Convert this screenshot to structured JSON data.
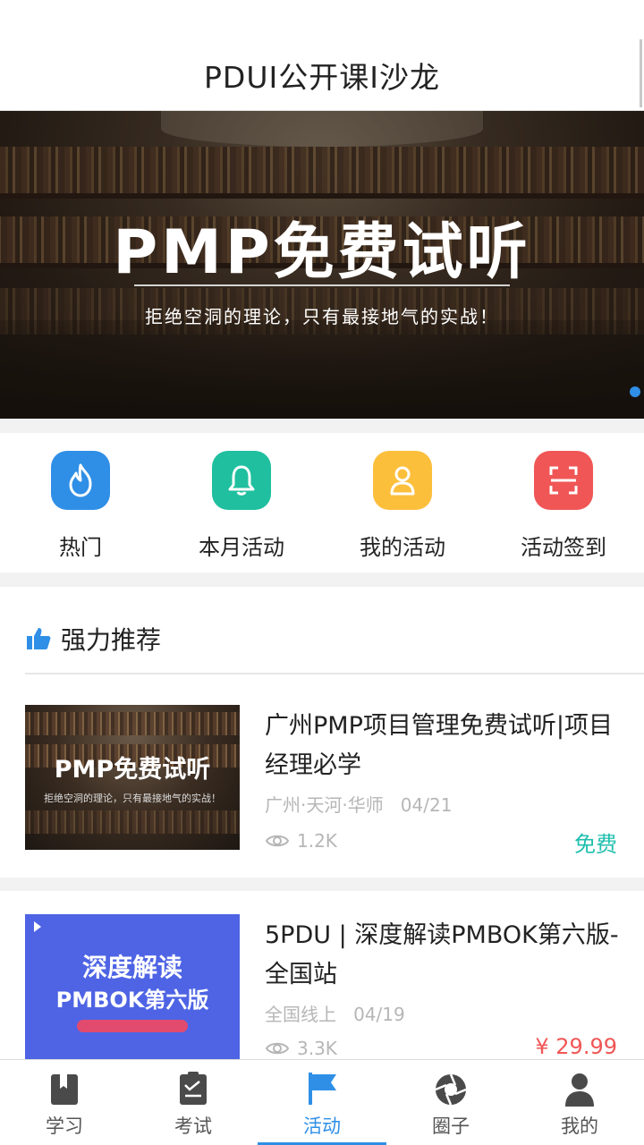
{
  "header": {
    "title": "PDUI公开课I沙龙"
  },
  "banner": {
    "headline": "PMP免费试听",
    "subtitle": "拒绝空洞的理论，只有最接地气的实战！"
  },
  "quick_actions": [
    {
      "label": "热门",
      "icon": "flame-icon",
      "color": "#2f8fe6"
    },
    {
      "label": "本月活动",
      "icon": "bell-icon",
      "color": "#1fbf9f"
    },
    {
      "label": "我的活动",
      "icon": "user-icon",
      "color": "#fcbf3c"
    },
    {
      "label": "活动签到",
      "icon": "scan-icon",
      "color": "#f05656"
    }
  ],
  "recommend": {
    "heading": "强力推荐",
    "icon": "thumbs-up-icon"
  },
  "cards": [
    {
      "thumb_title": "PMP免费试听",
      "thumb_sub": "拒绝空洞的理论，只有最接地气的实战！",
      "title": "广州PMP项目管理免费试听|项目经理必学",
      "location": "广州·天河·华师",
      "date": "04/21",
      "views": "1.2K",
      "price": "免费",
      "price_color": "#1fbfae"
    },
    {
      "thumb_line1": "深度解读",
      "thumb_line2": "PMBOK第六版",
      "title": "5PDU | 深度解读PMBOK第六版-全国站",
      "location": "全国线上",
      "date": "04/19",
      "views": "3.3K",
      "price": "¥ 29.99",
      "price_color": "#f05656"
    }
  ],
  "tabbar": {
    "active_color": "#2f8fe6",
    "tabs": [
      {
        "label": "学习",
        "icon": "book-icon"
      },
      {
        "label": "考试",
        "icon": "clipboard-icon"
      },
      {
        "label": "活动",
        "icon": "flag-icon",
        "active": true
      },
      {
        "label": "圈子",
        "icon": "aperture-icon"
      },
      {
        "label": "我的",
        "icon": "person-icon"
      }
    ]
  }
}
